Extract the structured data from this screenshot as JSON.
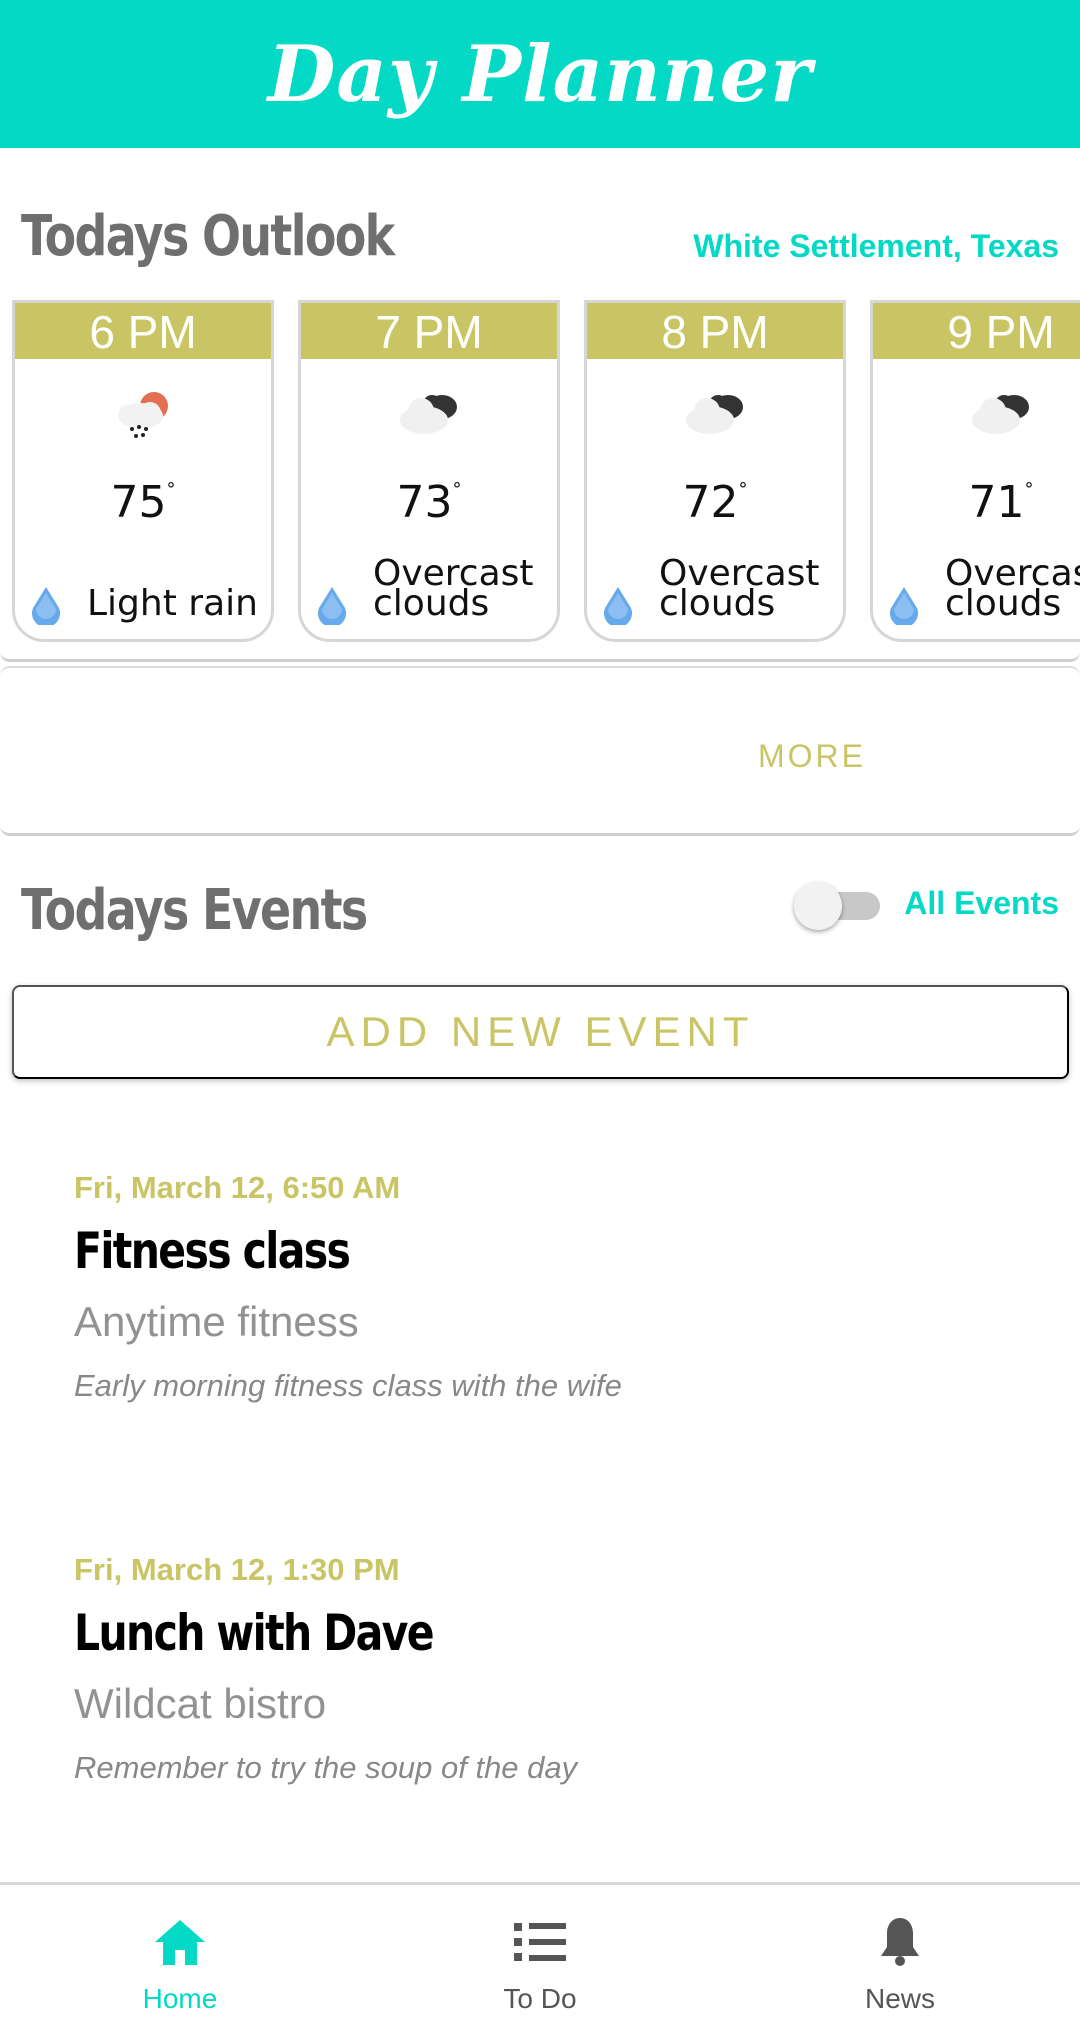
{
  "app": {
    "title": "Day Planner",
    "accent_color": "#03d9c5",
    "secondary_color": "#c9c565"
  },
  "outlook": {
    "title": "Todays Outlook",
    "location": "White Settlement, Texas",
    "hours": [
      {
        "time": "6 PM",
        "temp": "75",
        "degree": "°",
        "icon": "rain-cloud-sun-icon",
        "description": "Light rain"
      },
      {
        "time": "7 PM",
        "temp": "73",
        "degree": "°",
        "icon": "overcast-clouds-icon",
        "description": "Overcast clouds"
      },
      {
        "time": "8 PM",
        "temp": "72",
        "degree": "°",
        "icon": "overcast-clouds-icon",
        "description": "Overcast clouds"
      },
      {
        "time": "9 PM",
        "temp": "71",
        "degree": "°",
        "icon": "overcast-clouds-icon",
        "description": "Overcast clouds"
      }
    ],
    "more_label": "MORE"
  },
  "events": {
    "title": "Todays Events",
    "toggle_label": "All Events",
    "toggle_on": false,
    "add_label": "ADD NEW EVENT",
    "items": [
      {
        "date": "Fri, March 12, 6:50 AM",
        "title": "Fitness class",
        "location": "Anytime fitness",
        "note": "Early morning fitness class with the wife"
      },
      {
        "date": "Fri, March 12, 1:30 PM",
        "title": "Lunch with Dave",
        "location": "Wildcat bistro",
        "note": "Remember to try the soup of the day"
      }
    ]
  },
  "nav": {
    "items": [
      {
        "label": "Home",
        "icon": "home-icon",
        "active": true
      },
      {
        "label": "To Do",
        "icon": "list-icon",
        "active": false
      },
      {
        "label": "News",
        "icon": "bell-icon",
        "active": false
      }
    ]
  }
}
